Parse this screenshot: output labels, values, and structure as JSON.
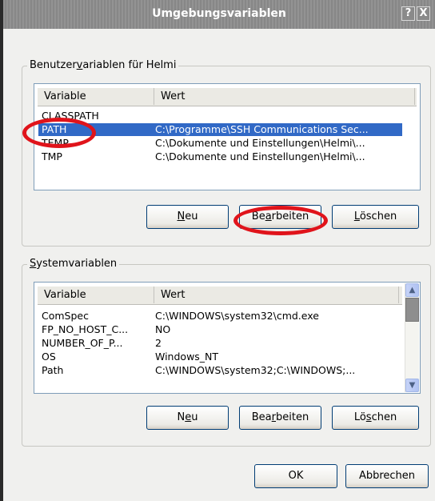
{
  "window": {
    "title": "Umgebungsvariablen",
    "help_glyph": "?",
    "close_glyph": "X"
  },
  "user_group": {
    "legend_pre": "Benutzer",
    "legend_u": "v",
    "legend_post": "ariablen für Helmi",
    "columns": [
      "Variable",
      "Wert"
    ],
    "rows": [
      {
        "variable": "CLASSPATH",
        "value": ""
      },
      {
        "variable": "PATH",
        "value": "C:\\Programme\\SSH Communications Sec..."
      },
      {
        "variable": "TEMP",
        "value": "C:\\Dokumente und Einstellungen\\Helmi\\..."
      },
      {
        "variable": "TMP",
        "value": "C:\\Dokumente und Einstellungen\\Helmi\\..."
      }
    ],
    "selected_row": "PATH",
    "buttons": {
      "new": {
        "pre": "",
        "u": "N",
        "post": "eu"
      },
      "edit": {
        "pre": "Be",
        "u": "a",
        "post": "rbeiten"
      },
      "delete": {
        "pre": "",
        "u": "L",
        "post": "öschen"
      }
    }
  },
  "system_group": {
    "legend_pre": "",
    "legend_u": "S",
    "legend_post": "ystemvariablen",
    "columns": [
      "Variable",
      "Wert"
    ],
    "rows": [
      {
        "variable": "ComSpec",
        "value": "C:\\WINDOWS\\system32\\cmd.exe"
      },
      {
        "variable": "FP_NO_HOST_C...",
        "value": "NO"
      },
      {
        "variable": "NUMBER_OF_P...",
        "value": "2"
      },
      {
        "variable": "OS",
        "value": "Windows_NT"
      },
      {
        "variable": "Path",
        "value": "C:\\WINDOWS\\system32;C:\\WINDOWS;..."
      }
    ],
    "buttons": {
      "new": {
        "pre": "N",
        "u": "e",
        "post": "u"
      },
      "edit": {
        "pre": "Bea",
        "u": "r",
        "post": "beiten"
      },
      "delete": {
        "pre": "Lö",
        "u": "s",
        "post": "chen"
      }
    },
    "scroll_up_glyph": "▲",
    "scroll_down_glyph": "▼"
  },
  "footer": {
    "ok_label": "OK",
    "cancel_label": "Abbrechen"
  },
  "colors": {
    "selection": "#3169c6",
    "highlight_ring": "#e0141b",
    "button_border": "#003c74"
  }
}
